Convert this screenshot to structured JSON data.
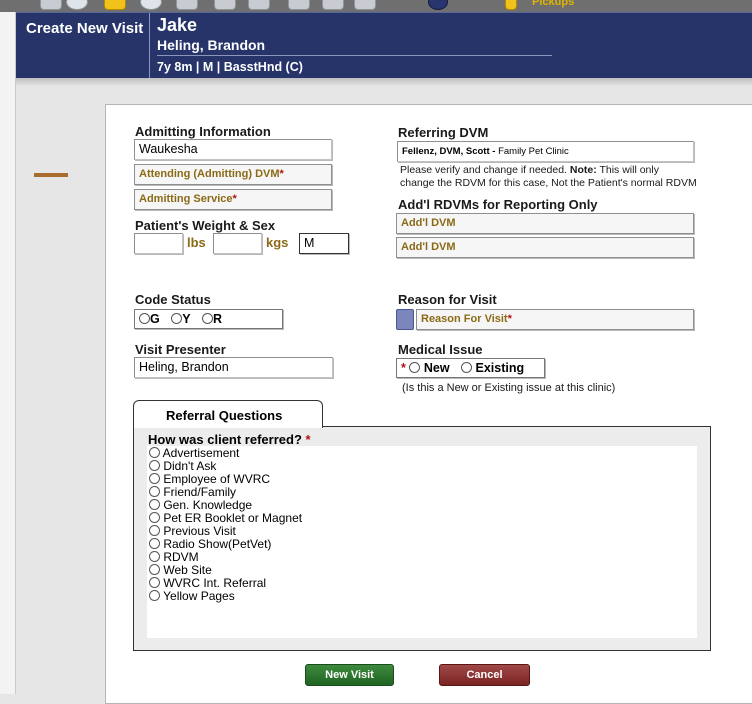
{
  "toolbar": {
    "icons": [
      "tool-icon",
      "globe-icon",
      "bell-icon",
      "globe-icon",
      "search-icon",
      "tag-icon",
      "calendar-icon",
      "pin-icon",
      "wrench-icon",
      "help-icon",
      "lock-icon"
    ],
    "partial_text": "Pickups"
  },
  "header": {
    "title": "Create New Visit",
    "pet_name": "Jake",
    "owner_name": "Heling, Brandon",
    "pet_info": "7y 8m | M | BasstHnd (C)"
  },
  "admitting": {
    "section_label": "Admitting Information",
    "location_value": "Waukesha",
    "dvm_label": "Attending (Admitting) DVM",
    "service_label": "Admitting Service",
    "required_mark": "*"
  },
  "weight": {
    "label": "Patient's Weight  & Sex",
    "lbs_value": "",
    "lbs_unit": "lbs",
    "kgs_value": "",
    "kgs_unit": "kgs",
    "sex_value": "M"
  },
  "referring": {
    "label": "Referring DVM",
    "dvm_name": "Fellenz, DVM, Scott - ",
    "clinic": "Family Pet Clinic",
    "note_line1_pre": "Please verify and change if needed. ",
    "note_bold": "Note:",
    "note_line1_post": " This will only",
    "note_line2": "change the RDVM for this case, Not the Patient's normal RDVM"
  },
  "addl": {
    "label": "Add'l RDVMs for Reporting Only",
    "dvm1": "Add'l DVM",
    "dvm2": "Add'l DVM"
  },
  "code_status": {
    "label": "Code Status",
    "options": [
      "G",
      "Y",
      "R"
    ]
  },
  "reason": {
    "label": "Reason for Visit",
    "picker_label": "Reason For Visit",
    "required_mark": "*"
  },
  "presenter": {
    "label": "Visit Presenter",
    "value": "Heling, Brandon"
  },
  "medical": {
    "label": "Medical Issue",
    "required_mark": "*",
    "options": [
      "New",
      "Existing"
    ],
    "hint": "(Is this a New or Existing issue at this clinic)"
  },
  "referral": {
    "tab_label": "Referral Questions",
    "question": "How was client referred?",
    "required_mark": "*",
    "options": [
      "Advertisement",
      "Didn't Ask",
      "Employee of WVRC",
      "Friend/Family",
      "Gen. Knowledge",
      "Pet ER Booklet or Magnet",
      "Previous Visit",
      "Radio Show(PetVet)",
      "RDVM",
      "Web Site",
      "WVRC Int. Referral",
      "Yellow Pages"
    ]
  },
  "buttons": {
    "new_visit": "New Visit",
    "cancel": "Cancel"
  },
  "colors": {
    "header": "#26346a",
    "picker_text": "#8b6a16",
    "required": "#b01313",
    "new_button": "#2d7a30",
    "cancel_button": "#8e3434"
  }
}
